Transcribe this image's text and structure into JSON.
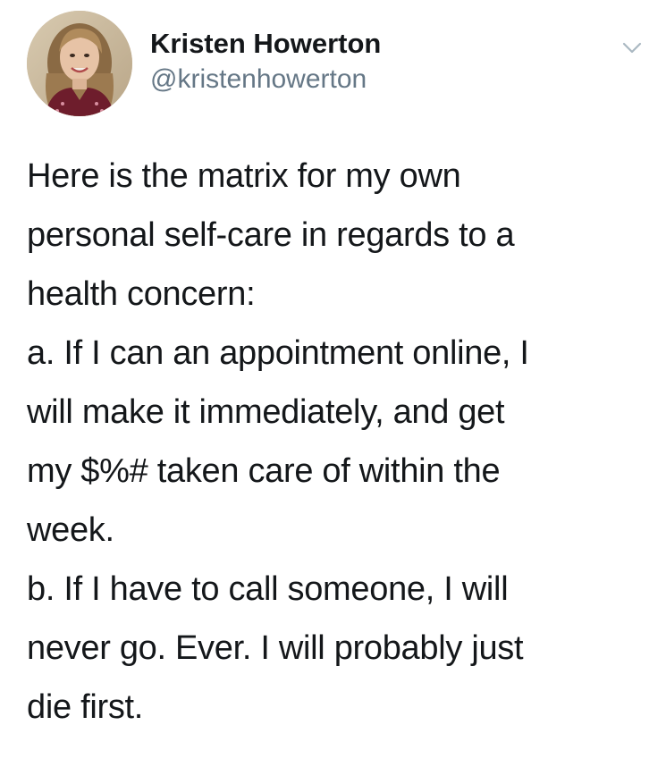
{
  "author": {
    "display_name": "Kristen Howerton",
    "handle": "@kristenhowerton",
    "avatar_icon": "profile-photo"
  },
  "menu": {
    "icon": "chevron-down-icon",
    "color": "#aab8c2"
  },
  "tweet": {
    "lines": [
      "Here is the matrix for my own",
      "personal self-care in regards to a",
      "health concern:",
      "a. If I can an appointment online, I",
      "will make it immediately, and get",
      "my $%# taken care of within the",
      "week.",
      "b. If I have to call someone, I will",
      "never go. Ever. I will probably just",
      "die first."
    ]
  },
  "colors": {
    "text": "#14171a",
    "handle": "#657786",
    "background": "#ffffff"
  }
}
